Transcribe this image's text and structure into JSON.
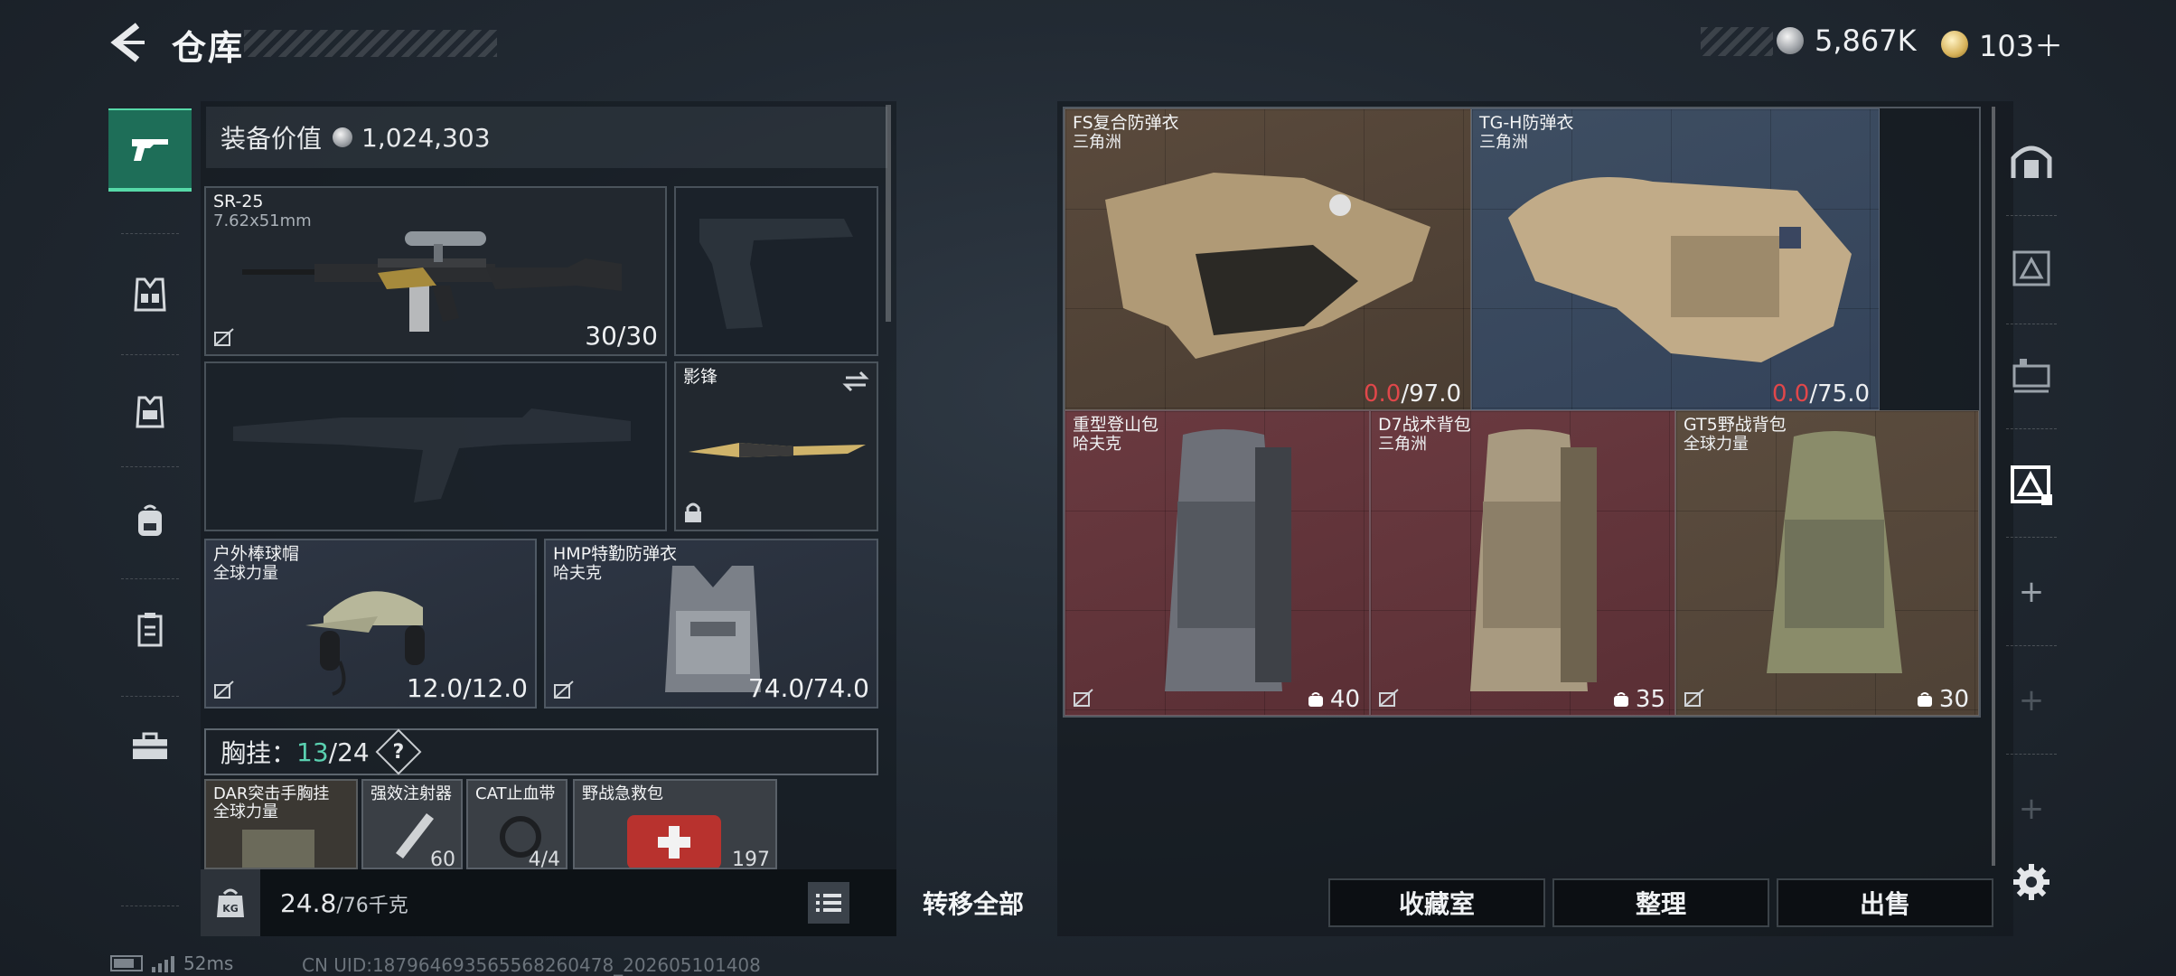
{
  "header": {
    "title": "仓库",
    "currency_silver": "5,867K",
    "currency_gold": "103＋"
  },
  "left_nav": {
    "items": [
      "weapon-icon",
      "chest-rig-icon",
      "armor-icon",
      "backpack-icon",
      "case-icon",
      "toolbox-icon"
    ],
    "active": 0
  },
  "loadout": {
    "value_label": "装备价值",
    "value": "1,024,303",
    "primary": {
      "name": "SR-25",
      "caliber": "7.62x51mm",
      "ammo": "30/30"
    },
    "melee": {
      "name": "影锋"
    },
    "helmet": {
      "name": "户外棒球帽",
      "brand": "全球力量",
      "durability": "12.0/12.0"
    },
    "armor": {
      "name": "HMP特勤防弹衣",
      "brand": "哈夫克",
      "durability": "74.0/74.0"
    },
    "chest_rig": {
      "label": "胸挂：",
      "used": "13",
      "total": "/24",
      "help": "?"
    },
    "rig_items": [
      {
        "name": "DAR突击手胸挂",
        "brand": "全球力量"
      },
      {
        "name": "强效注射器",
        "count": "60"
      },
      {
        "name": "CAT止血带",
        "count": "4/4"
      },
      {
        "name": "野战急救包",
        "count": "197"
      }
    ],
    "weight": "24.8",
    "weight_max": "/76千克",
    "weight_icon": "KG",
    "transfer_all": "转移全部"
  },
  "storage": {
    "items": [
      {
        "name": "FS复合防弹衣",
        "brand": "三角洲",
        "dur_current": "0.0",
        "dur_max": "/97.0",
        "color": "brown"
      },
      {
        "name": "TG-H防弹衣",
        "brand": "三角洲",
        "dur_current": "0.0",
        "dur_max": "/75.0",
        "color": "blue"
      },
      {
        "name": "重型登山包",
        "brand": "哈夫克",
        "capacity": "40",
        "color": "red"
      },
      {
        "name": "D7战术背包",
        "brand": "三角洲",
        "capacity": "35",
        "color": "red"
      },
      {
        "name": "GT5野战背包",
        "brand": "全球力量",
        "capacity": "30",
        "color": "olive"
      }
    ],
    "buttons": {
      "collection": "收藏室",
      "sort": "整理",
      "sell": "出售"
    }
  },
  "right_nav": {
    "items": [
      "safe-room-icon",
      "storage-1-icon",
      "storage-2-icon",
      "storage-3-icon",
      "add-icon",
      "add-icon",
      "add-icon",
      "settings-icon"
    ]
  },
  "footer": {
    "ping": "52ms",
    "uid": "CN UID:187964693565568260478_202605101408"
  },
  "colors": {
    "accent_green": "#1e6e58",
    "durability_red": "#e0474a",
    "slot_red": "#6a3a40",
    "slot_brown": "#5a4a3c",
    "slot_blue": "#3e4e62"
  }
}
